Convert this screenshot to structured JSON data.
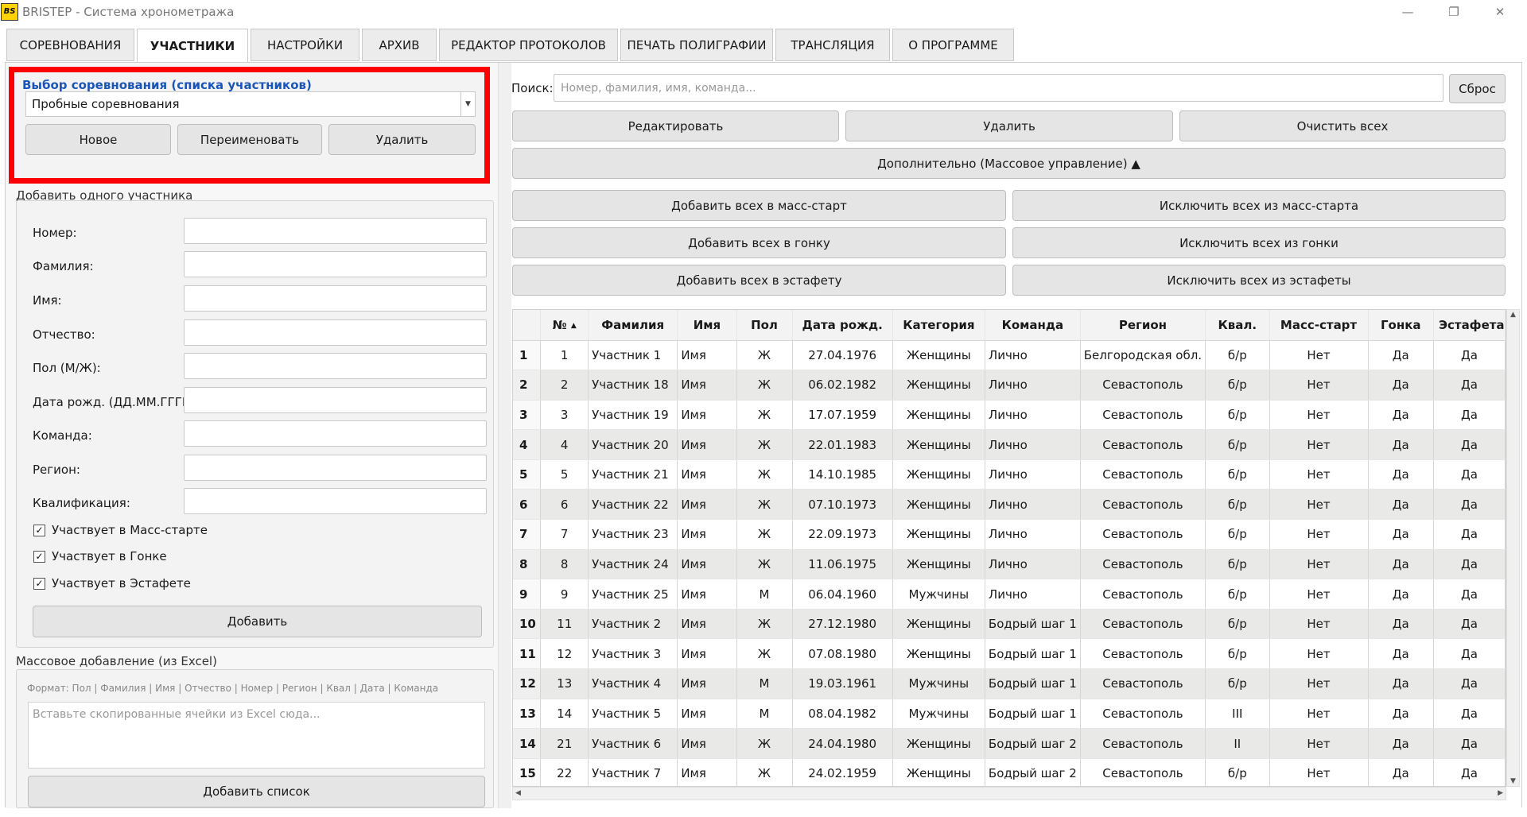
{
  "window": {
    "logo": "BS",
    "title": "BRISTEP - Система хронометража",
    "controls": {
      "minimize": "—",
      "restore": "❐",
      "close": "✕"
    }
  },
  "tabs": [
    {
      "label": "СОРЕВНОВАНИЯ"
    },
    {
      "label": "УЧАСТНИКИ",
      "active": true
    },
    {
      "label": "НАСТРОЙКИ"
    },
    {
      "label": "АРХИВ"
    },
    {
      "label": "РЕДАКТОР ПРОТОКОЛОВ"
    },
    {
      "label": "ПЕЧАТЬ ПОЛИГРАФИИ"
    },
    {
      "label": "ТРАНСЛЯЦИЯ"
    },
    {
      "label": "О ПРОГРАММЕ"
    }
  ],
  "competition": {
    "title": "Выбор соревнования (списка участников)",
    "selected": "Пробные соревнования",
    "new_label": "Новое",
    "rename_label": "Переименовать",
    "delete_label": "Удалить"
  },
  "add_one": {
    "title": "Добавить одного участника",
    "fields": [
      "Номер:",
      "Фамилия:",
      "Имя:",
      "Отчество:",
      "Пол (М/Ж):",
      "Дата рожд. (ДД.ММ.ГГГГ):",
      "Команда:",
      "Регион:",
      "Квалификация:"
    ],
    "checkboxes": [
      {
        "label": "Участвует в Масс-старте",
        "checked": true
      },
      {
        "label": "Участвует в Гонке",
        "checked": true
      },
      {
        "label": "Участвует в Эстафете",
        "checked": true
      }
    ],
    "add_label": "Добавить"
  },
  "bulk": {
    "title": "Массовое добавление (из Excel)",
    "format": "Формат: Пол | Фамилия | Имя | Отчество | Номер | Регион | Квал | Дата | Команда",
    "placeholder": "Вставьте скопированные ячейки из Excel сюда...",
    "add_list_label": "Добавить список"
  },
  "search": {
    "label": "Поиск:",
    "placeholder": "Номер, фамилия, имя, команда...",
    "reset_label": "Сброс"
  },
  "actions": {
    "edit": "Редактировать",
    "delete": "Удалить",
    "clear_all": "Очистить всех"
  },
  "extra": {
    "label": "Дополнительно (Массовое управление) ▲"
  },
  "mass": {
    "add_mass": "Добавить всех в масс-старт",
    "exclude_mass": "Исключить всех из масс-старта",
    "add_race": "Добавить всех в гонку",
    "exclude_race": "Исключить всех из гонки",
    "add_relay": "Добавить всех в эстафету",
    "exclude_relay": "Исключить всех из эстафеты"
  },
  "table": {
    "columns": [
      "№",
      "Фамилия",
      "Имя",
      "Пол",
      "Дата рожд.",
      "Категория",
      "Команда",
      "Регион",
      "Квал.",
      "Масс-старт",
      "Гонка",
      "Эстафета"
    ],
    "sort_indicator": "▲",
    "rows": [
      [
        "1",
        "1",
        "Участник 1",
        "Имя",
        "Ж",
        "27.04.1976",
        "Женщины",
        "Лично",
        "Белгородская обл.",
        "б/р",
        "Нет",
        "Да",
        "Да"
      ],
      [
        "2",
        "2",
        "Участник 18",
        "Имя",
        "Ж",
        "06.02.1982",
        "Женщины",
        "Лично",
        "Севастополь",
        "б/р",
        "Нет",
        "Да",
        "Да"
      ],
      [
        "3",
        "3",
        "Участник 19",
        "Имя",
        "Ж",
        "17.07.1959",
        "Женщины",
        "Лично",
        "Севастополь",
        "б/р",
        "Нет",
        "Да",
        "Да"
      ],
      [
        "4",
        "4",
        "Участник 20",
        "Имя",
        "Ж",
        "22.01.1983",
        "Женщины",
        "Лично",
        "Севастополь",
        "б/р",
        "Нет",
        "Да",
        "Да"
      ],
      [
        "5",
        "5",
        "Участник 21",
        "Имя",
        "Ж",
        "14.10.1985",
        "Женщины",
        "Лично",
        "Севастополь",
        "б/р",
        "Нет",
        "Да",
        "Да"
      ],
      [
        "6",
        "6",
        "Участник 22",
        "Имя",
        "Ж",
        "07.10.1973",
        "Женщины",
        "Лично",
        "Севастополь",
        "б/р",
        "Нет",
        "Да",
        "Да"
      ],
      [
        "7",
        "7",
        "Участник 23",
        "Имя",
        "Ж",
        "22.09.1973",
        "Женщины",
        "Лично",
        "Севастополь",
        "б/р",
        "Нет",
        "Да",
        "Да"
      ],
      [
        "8",
        "8",
        "Участник 24",
        "Имя",
        "Ж",
        "11.06.1975",
        "Женщины",
        "Лично",
        "Севастополь",
        "б/р",
        "Нет",
        "Да",
        "Да"
      ],
      [
        "9",
        "9",
        "Участник 25",
        "Имя",
        "М",
        "06.04.1960",
        "Мужчины",
        "Лично",
        "Севастополь",
        "б/р",
        "Нет",
        "Да",
        "Да"
      ],
      [
        "10",
        "11",
        "Участник 2",
        "Имя",
        "Ж",
        "27.12.1980",
        "Женщины",
        "Бодрый шаг 1",
        "Севастополь",
        "б/р",
        "Нет",
        "Да",
        "Да"
      ],
      [
        "11",
        "12",
        "Участник 3",
        "Имя",
        "Ж",
        "07.08.1980",
        "Женщины",
        "Бодрый шаг 1",
        "Севастополь",
        "б/р",
        "Нет",
        "Да",
        "Да"
      ],
      [
        "12",
        "13",
        "Участник 4",
        "Имя",
        "М",
        "19.03.1961",
        "Мужчины",
        "Бодрый шаг 1",
        "Севастополь",
        "б/р",
        "Нет",
        "Да",
        "Да"
      ],
      [
        "13",
        "14",
        "Участник 5",
        "Имя",
        "М",
        "08.04.1982",
        "Мужчины",
        "Бодрый шаг 1",
        "Севастополь",
        "III",
        "Нет",
        "Да",
        "Да"
      ],
      [
        "14",
        "21",
        "Участник 6",
        "Имя",
        "Ж",
        "24.04.1980",
        "Женщины",
        "Бодрый шаг 2",
        "Севастополь",
        "II",
        "Нет",
        "Да",
        "Да"
      ],
      [
        "15",
        "22",
        "Участник 7",
        "Имя",
        "Ж",
        "24.02.1959",
        "Женщины",
        "Бодрый шаг 2",
        "Севастополь",
        "б/р",
        "Нет",
        "Да",
        "Да"
      ]
    ]
  }
}
